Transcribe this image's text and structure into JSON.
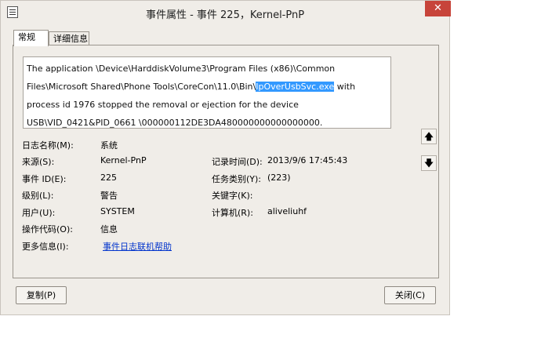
{
  "window": {
    "title": "事件属性 - 事件 225，Kernel-PnP",
    "close_glyph": "✕"
  },
  "tabs": [
    {
      "label": "常规",
      "active": true
    },
    {
      "label": "详细信息",
      "active": false
    }
  ],
  "description": {
    "before": "The application \\Device\\HarddiskVolume3\\Program Files (x86)\\Common Files\\Microsoft Shared\\Phone Tools\\CoreCon\\11.0\\Bin\\",
    "highlighted": "IpOverUsbSvc.exe",
    "after": " with process id 1976 stopped the removal or ejection for the device USB\\VID_0421&PID_0661 \\000000112DE3DA480000000000000000."
  },
  "fields": {
    "log_name": {
      "label": "日志名称(M):",
      "value": "系统"
    },
    "source": {
      "label": "来源(S):",
      "value": "Kernel-PnP"
    },
    "logged": {
      "label": "记录时间(D):",
      "value": "2013/9/6 17:45:43"
    },
    "event_id": {
      "label": "事件 ID(E):",
      "value": "225"
    },
    "task_category": {
      "label": "任务类别(Y):",
      "value": "(223)"
    },
    "level": {
      "label": "级别(L):",
      "value": "警告"
    },
    "keywords": {
      "label": "关键字(K):",
      "value": ""
    },
    "user": {
      "label": "用户(U):",
      "value": "SYSTEM"
    },
    "computer": {
      "label": "计算机(R):",
      "value": "aliveliuhf"
    },
    "opcode": {
      "label": "操作代码(O):",
      "value": "信息"
    },
    "more_info": {
      "label": "更多信息(I):",
      "link": "事件日志联机帮助"
    }
  },
  "nav": {
    "up_glyph": "🡅",
    "down_glyph": "🡇"
  },
  "buttons": {
    "copy": "复制(P)",
    "close": "关闭(C)"
  }
}
